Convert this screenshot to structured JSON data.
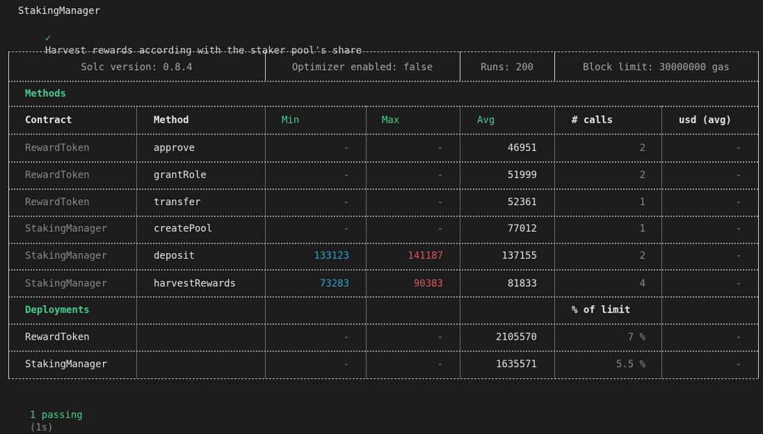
{
  "suite": {
    "title": "StakingManager",
    "test_check": "✓",
    "test_name": "Harvest rewards according with the staker pool's share"
  },
  "config": {
    "solc": "Solc version: 0.8.4",
    "optimizer": "Optimizer enabled: false",
    "runs": "Runs: 200",
    "block_limit": "Block limit: 30000000 gas"
  },
  "methods_section": {
    "title": "Methods",
    "headers": {
      "contract": "Contract",
      "method": "Method",
      "min": "Min",
      "max": "Max",
      "avg": "Avg",
      "calls": "# calls",
      "usd": "usd (avg)"
    },
    "rows": [
      {
        "contract": "RewardToken",
        "method": "approve",
        "min": "-",
        "max": "-",
        "avg": "46951",
        "calls": "2",
        "usd": "-"
      },
      {
        "contract": "RewardToken",
        "method": "grantRole",
        "min": "-",
        "max": "-",
        "avg": "51999",
        "calls": "2",
        "usd": "-"
      },
      {
        "contract": "RewardToken",
        "method": "transfer",
        "min": "-",
        "max": "-",
        "avg": "52361",
        "calls": "1",
        "usd": "-"
      },
      {
        "contract": "StakingManager",
        "method": "createPool",
        "min": "-",
        "max": "-",
        "avg": "77012",
        "calls": "1",
        "usd": "-"
      },
      {
        "contract": "StakingManager",
        "method": "deposit",
        "min": "133123",
        "max": "141187",
        "avg": "137155",
        "calls": "2",
        "usd": "-"
      },
      {
        "contract": "StakingManager",
        "method": "harvestRewards",
        "min": "73283",
        "max": "90383",
        "avg": "81833",
        "calls": "4",
        "usd": "-"
      }
    ]
  },
  "deployments_section": {
    "title": "Deployments",
    "limit_header": "% of limit",
    "rows": [
      {
        "contract": "RewardToken",
        "min": "-",
        "max": "-",
        "avg": "2105570",
        "limit": "7 %",
        "usd": "-"
      },
      {
        "contract": "StakingManager",
        "min": "-",
        "max": "-",
        "avg": "1635571",
        "limit": "5.5 %",
        "usd": "-"
      }
    ]
  },
  "summary": {
    "passing": "1 passing",
    "duration": "(1s)"
  },
  "colors": {
    "background": "#1c1c1c",
    "section_green": "#3fcf8e",
    "min_cyan": "#21a7d4",
    "max_red": "#e0575a",
    "dim_grey": "#8a8a8a"
  }
}
